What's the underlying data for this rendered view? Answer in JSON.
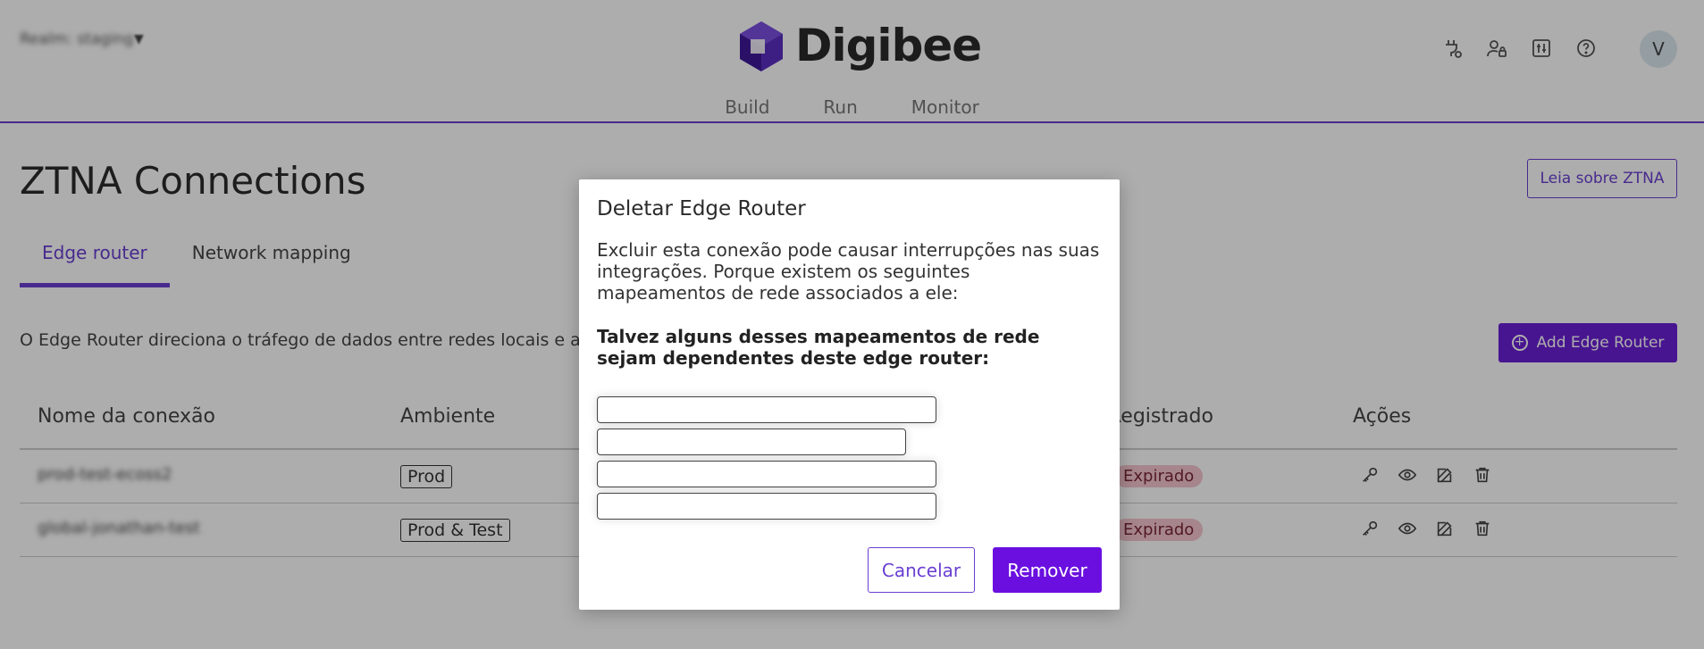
{
  "header": {
    "realm": "Realm: staging",
    "logo_text": "Digibee",
    "nav": [
      "Build",
      "Run",
      "Monitor"
    ],
    "icons": [
      "plug-status-icon",
      "user-lock-icon",
      "settings-panel-icon",
      "help-icon"
    ],
    "avatar_letter": "V"
  },
  "page": {
    "title": "ZTNA Connections",
    "read_button": "Leia sobre ZTNA",
    "tabs": [
      {
        "label": "Edge router",
        "active": true
      },
      {
        "label": "Network mapping",
        "active": false
      }
    ],
    "description": "O Edge Router direciona o tráfego de dados entre redes locais e a Inter",
    "add_button": "Add Edge Router"
  },
  "table": {
    "headers": [
      "Nome da conexão",
      "Ambiente",
      "Registrado",
      "Ações"
    ],
    "rows": [
      {
        "name": "prod-test-ecoss2",
        "env": "Prod",
        "status": "Expirado"
      },
      {
        "name": "global-jonathan-test",
        "env": "Prod & Test",
        "status": "Expirado"
      }
    ]
  },
  "modal": {
    "title": "Deletar Edge Router",
    "message": "Excluir esta conexão pode causar interrupções nas suas integrações. Porque existem os seguintes mapeamentos de rede associados a ele:",
    "warning": "Talvez alguns desses mapeamentos de rede sejam dependentes deste edge router:",
    "mappings_count": 4,
    "cancel_label": "Cancelar",
    "remove_label": "Remover"
  },
  "colors": {
    "brand": "#6a3fd1",
    "primary_button": "#6a0fe0",
    "expired_badge_bg": "#f5c6cf"
  }
}
